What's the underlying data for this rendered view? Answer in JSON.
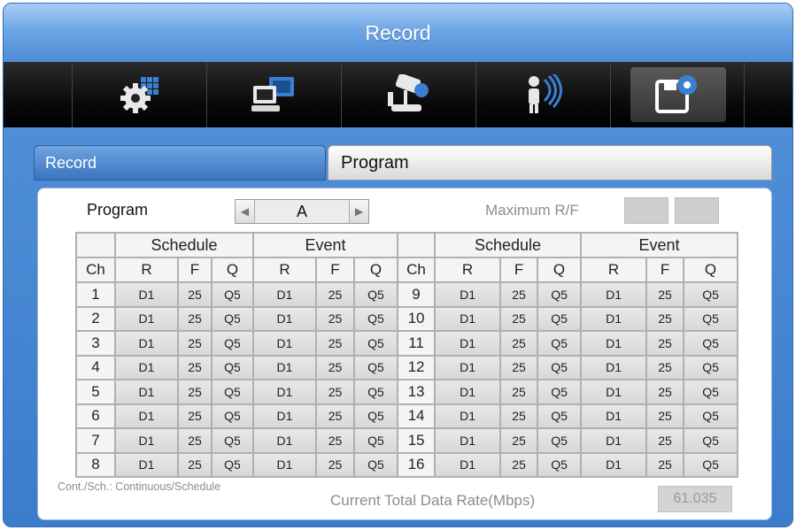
{
  "window": {
    "title": "Record"
  },
  "toolbar": {
    "icons": [
      "settings-grid-icon",
      "network-computer-icon",
      "camera-joystick-icon",
      "person-alarm-icon",
      "record-disk-icon"
    ],
    "active_index": 4
  },
  "tabs": {
    "record": "Record",
    "program": "Program"
  },
  "program": {
    "label": "Program",
    "value": "A"
  },
  "max_rf": {
    "label": "Maximum R/F",
    "values": [
      "",
      ""
    ]
  },
  "table": {
    "group_headers": [
      "Schedule",
      "Event",
      "Schedule",
      "Event"
    ],
    "sub_headers": [
      "Ch",
      "R",
      "F",
      "Q",
      "R",
      "F",
      "Q",
      "Ch",
      "R",
      "F",
      "Q",
      "R",
      "F",
      "Q"
    ],
    "rows": [
      [
        "1",
        "D1",
        "25",
        "Q5",
        "D1",
        "25",
        "Q5",
        "9",
        "D1",
        "25",
        "Q5",
        "D1",
        "25",
        "Q5"
      ],
      [
        "2",
        "D1",
        "25",
        "Q5",
        "D1",
        "25",
        "Q5",
        "10",
        "D1",
        "25",
        "Q5",
        "D1",
        "25",
        "Q5"
      ],
      [
        "3",
        "D1",
        "25",
        "Q5",
        "D1",
        "25",
        "Q5",
        "11",
        "D1",
        "25",
        "Q5",
        "D1",
        "25",
        "Q5"
      ],
      [
        "4",
        "D1",
        "25",
        "Q5",
        "D1",
        "25",
        "Q5",
        "12",
        "D1",
        "25",
        "Q5",
        "D1",
        "25",
        "Q5"
      ],
      [
        "5",
        "D1",
        "25",
        "Q5",
        "D1",
        "25",
        "Q5",
        "13",
        "D1",
        "25",
        "Q5",
        "D1",
        "25",
        "Q5"
      ],
      [
        "6",
        "D1",
        "25",
        "Q5",
        "D1",
        "25",
        "Q5",
        "14",
        "D1",
        "25",
        "Q5",
        "D1",
        "25",
        "Q5"
      ],
      [
        "7",
        "D1",
        "25",
        "Q5",
        "D1",
        "25",
        "Q5",
        "15",
        "D1",
        "25",
        "Q5",
        "D1",
        "25",
        "Q5"
      ],
      [
        "8",
        "D1",
        "25",
        "Q5",
        "D1",
        "25",
        "Q5",
        "16",
        "D1",
        "25",
        "Q5",
        "D1",
        "25",
        "Q5"
      ]
    ]
  },
  "footer": {
    "note": "Cont./Sch.: Continuous/Schedule",
    "rate_label": "Current Total Data Rate(Mbps)",
    "rate_value": "61.035"
  },
  "colors": {
    "accent": "#3e80cc",
    "title_text": "#ffffff",
    "disabled_text": "#8c8c8c"
  }
}
